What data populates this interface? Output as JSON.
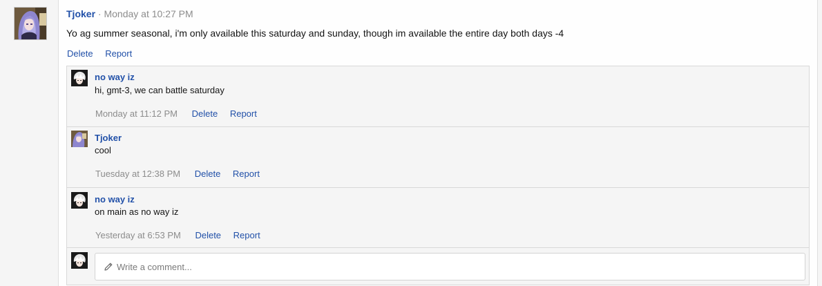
{
  "post": {
    "author": "Tjoker",
    "separator": "·",
    "timestamp": "Monday at 10:27 PM",
    "body": "Yo ag summer seasonal, i'm only available this saturday and sunday, though im available the entire day both days -4",
    "actions": {
      "delete": "Delete",
      "report": "Report"
    }
  },
  "comments": [
    {
      "author": "no way iz",
      "text": "hi, gmt-3, we can battle saturday",
      "timestamp": "Monday at 11:12 PM",
      "delete": "Delete",
      "report": "Report"
    },
    {
      "author": "Tjoker",
      "text": "cool",
      "timestamp": "Tuesday at 12:38 PM",
      "delete": "Delete",
      "report": "Report"
    },
    {
      "author": "no way iz",
      "text": "on main as no way iz",
      "timestamp": "Yesterday at 6:53 PM",
      "delete": "Delete",
      "report": "Report"
    }
  ],
  "comment_box": {
    "placeholder": "Write a comment..."
  },
  "icons": {
    "pencil": "pencil-icon"
  },
  "colors": {
    "link": "#2150a8",
    "muted": "#8c8c8c",
    "panel_bg": "#f5f5f5"
  }
}
